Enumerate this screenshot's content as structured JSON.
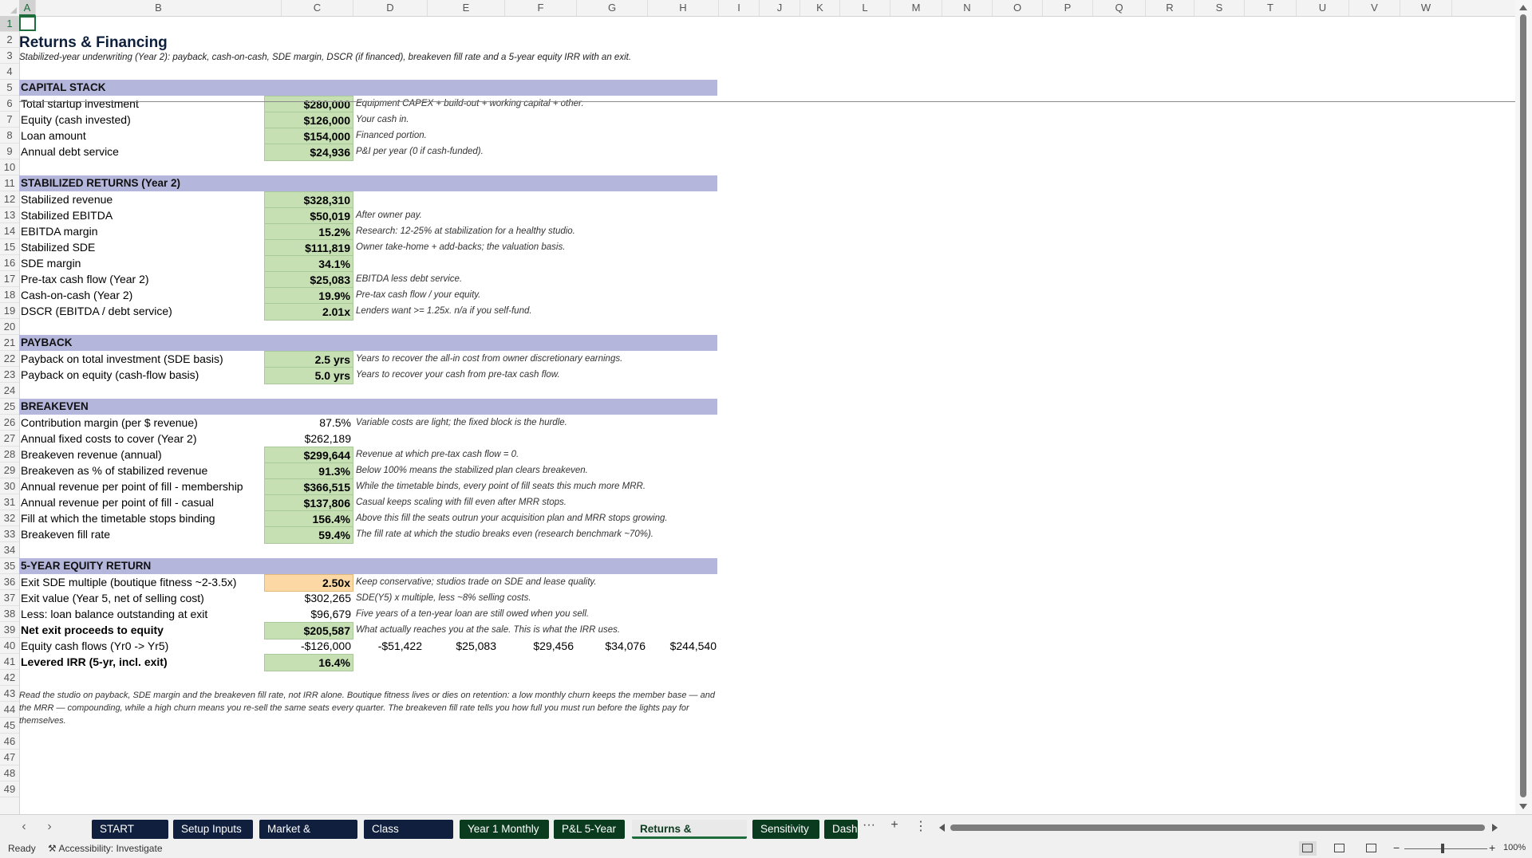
{
  "columns": [
    "A",
    "B",
    "C",
    "D",
    "E",
    "F",
    "G",
    "H",
    "I",
    "J",
    "K",
    "L",
    "M",
    "N",
    "O",
    "P",
    "Q",
    "R",
    "S",
    "T",
    "U",
    "V",
    "W"
  ],
  "sheet": {
    "title": "Returns & Financing",
    "subtitle": "Stabilized-year underwriting (Year 2): payback, cash-on-cash, SDE margin, DSCR (if financed), breakeven fill rate and a 5-year equity IRR with an exit.",
    "sections": {
      "capital": "CAPITAL STACK",
      "returns": "STABILIZED RETURNS (Year 2)",
      "payback": "PAYBACK",
      "breakeven": "BREAKEVEN",
      "equity": "5-YEAR EQUITY RETURN"
    },
    "rows": [
      {
        "r": 6,
        "label": "Total startup investment",
        "value": "$280,000",
        "style": "hl",
        "note": "Equipment CAPEX + build-out + working capital + other."
      },
      {
        "r": 7,
        "label": "Equity (cash invested)",
        "value": "$126,000",
        "style": "hl",
        "note": "Your cash in."
      },
      {
        "r": 8,
        "label": "Loan amount",
        "value": "$154,000",
        "style": "hl",
        "note": "Financed portion."
      },
      {
        "r": 9,
        "label": "Annual debt service",
        "value": "$24,936",
        "style": "hl",
        "note": "P&I per year (0 if cash-funded)."
      },
      {
        "r": 12,
        "label": "Stabilized revenue",
        "value": "$328,310",
        "style": "hl",
        "note": ""
      },
      {
        "r": 13,
        "label": "Stabilized EBITDA",
        "value": "$50,019",
        "style": "hl",
        "note": "After owner pay."
      },
      {
        "r": 14,
        "label": "EBITDA margin",
        "value": "15.2%",
        "style": "hl",
        "note": "Research: 12-25% at stabilization for a healthy studio."
      },
      {
        "r": 15,
        "label": "Stabilized SDE",
        "value": "$111,819",
        "style": "hl",
        "note": "Owner take-home + add-backs; the valuation basis."
      },
      {
        "r": 16,
        "label": "SDE margin",
        "value": "34.1%",
        "style": "hl",
        "note": ""
      },
      {
        "r": 17,
        "label": "Pre-tax cash flow (Year 2)",
        "value": "$25,083",
        "style": "hl",
        "note": "EBITDA less debt service."
      },
      {
        "r": 18,
        "label": "Cash-on-cash (Year 2)",
        "value": "19.9%",
        "style": "hl",
        "note": "Pre-tax cash flow / your equity."
      },
      {
        "r": 19,
        "label": "DSCR (EBITDA / debt service)",
        "value": "2.01x",
        "style": "hl",
        "note": "Lenders want >= 1.25x. n/a if you self-fund."
      },
      {
        "r": 22,
        "label": "Payback on total investment (SDE basis)",
        "value": "2.5 yrs",
        "style": "hl",
        "note": "Years to recover the all-in cost from owner discretionary earnings."
      },
      {
        "r": 23,
        "label": "Payback on equity (cash-flow basis)",
        "value": "5.0 yrs",
        "style": "hl",
        "note": "Years to recover your cash from pre-tax cash flow."
      },
      {
        "r": 26,
        "label": "Contribution margin (per $ revenue)",
        "value": "87.5%",
        "style": "plain",
        "note": "Variable costs are light; the fixed block is the hurdle."
      },
      {
        "r": 27,
        "label": "Annual fixed costs to cover (Year 2)",
        "value": "$262,189",
        "style": "plain",
        "note": ""
      },
      {
        "r": 28,
        "label": "Breakeven revenue (annual)",
        "value": "$299,644",
        "style": "hl",
        "note": "Revenue at which pre-tax cash flow = 0."
      },
      {
        "r": 29,
        "label": "Breakeven as % of stabilized revenue",
        "value": "91.3%",
        "style": "hl",
        "note": "Below 100% means the stabilized plan clears breakeven."
      },
      {
        "r": 30,
        "label": "Annual revenue per point of fill - membership",
        "value": "$366,515",
        "style": "hl",
        "note": "While the timetable binds, every point of fill seats this much more MRR."
      },
      {
        "r": 31,
        "label": "Annual revenue per point of fill - casual",
        "value": "$137,806",
        "style": "hl",
        "note": "Casual keeps scaling with fill even after MRR stops."
      },
      {
        "r": 32,
        "label": "Fill at which the timetable stops binding",
        "value": "156.4%",
        "style": "hl",
        "note": "Above this fill the seats outrun your acquisition plan and MRR stops growing."
      },
      {
        "r": 33,
        "label": "Breakeven fill rate",
        "value": "59.4%",
        "style": "hl",
        "note": "The fill rate at which the studio breaks even (research benchmark ~70%)."
      },
      {
        "r": 36,
        "label": "Exit SDE multiple (boutique fitness ~2-3.5x)",
        "value": "2.50x",
        "style": "in",
        "note": "Keep conservative; studios trade on SDE and lease quality."
      },
      {
        "r": 37,
        "label": "Exit value (Year 5, net of selling cost)",
        "value": "$302,265",
        "style": "plain",
        "note": "SDE(Y5) x multiple, less ~8% selling costs."
      },
      {
        "r": 38,
        "label": "Less: loan balance outstanding at exit",
        "value": "$96,679",
        "style": "plain",
        "note": "Five years of a ten-year loan are still owed when you sell."
      },
      {
        "r": 39,
        "label": "Net exit proceeds to equity",
        "value": "$205,587",
        "style": "hl",
        "note": "What actually reaches you at the sale. This is what the IRR uses.",
        "bold": true
      },
      {
        "r": 41,
        "label": "Levered IRR (5-yr, incl. exit)",
        "value": "16.4%",
        "style": "hl",
        "note": "",
        "bold": true
      }
    ],
    "cash_flows": {
      "label": "Equity cash flows (Yr0 -> Yr5)",
      "values": [
        "-$126,000",
        "-$51,422",
        "$25,083",
        "$29,456",
        "$34,076",
        "$244,540"
      ]
    },
    "footnote": "Read the studio on payback, SDE margin and the breakeven fill rate, not IRR alone. Boutique fitness lives or dies on retention: a low monthly churn keeps the member base — and the MRR — compounding, while a high churn means you re-sell the same seats every quarter. The breakeven fill rate tells you how full you must run before the lights pay for themselves."
  },
  "tabs": [
    {
      "label": "START HERE",
      "color": "#0f1f3d",
      "active": false
    },
    {
      "label": "Setup Inputs",
      "color": "#0f1f3d",
      "active": false
    },
    {
      "label": "Market & Season",
      "color": "#0f1f3d",
      "active": false
    },
    {
      "label": "Class Schedule",
      "color": "#0f1f3d",
      "active": false
    },
    {
      "label": "Year 1 Monthly",
      "color": "#0b3b1f",
      "active": false
    },
    {
      "label": "P&L 5-Year",
      "color": "#0b3b1f",
      "active": false
    },
    {
      "label": "Returns & Financing",
      "color": "#0b3b1f",
      "active": true
    },
    {
      "label": "Sensitivity",
      "color": "#0b3b1f",
      "active": false
    },
    {
      "label": "Dash",
      "color": "#0b3b1f",
      "active": false
    }
  ],
  "tab_controls": {
    "more": "···",
    "add": "+",
    "options": "⋮",
    "prev": "‹",
    "next": "›"
  },
  "status": {
    "ready": "Ready",
    "accessibility": "Accessibility: Investigate",
    "zoom_minus": "−",
    "zoom_plus": "+",
    "zoom": "100%"
  }
}
